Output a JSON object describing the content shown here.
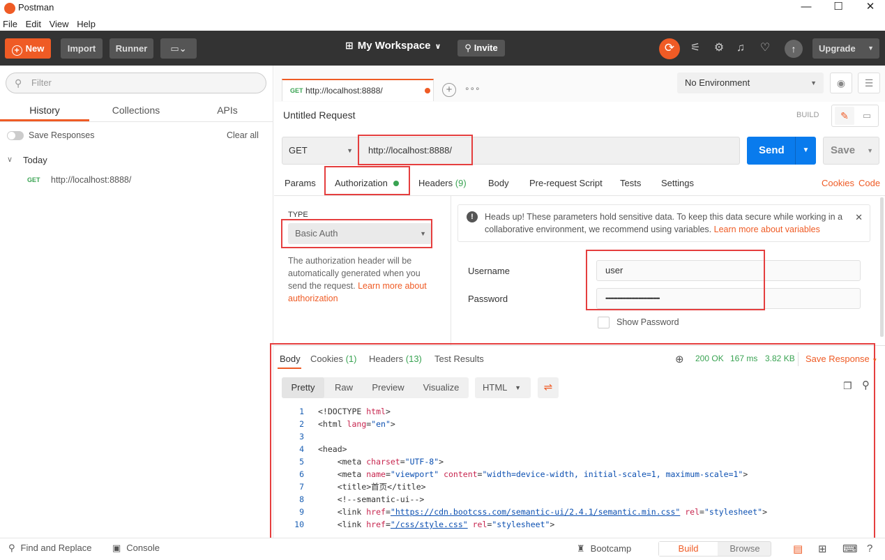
{
  "app": {
    "title": "Postman",
    "window_controls": {
      "minimize": "—",
      "maximize": "☐",
      "close": "✕"
    }
  },
  "menu": [
    "File",
    "Edit",
    "View",
    "Help"
  ],
  "toolbar": {
    "new_label": "New",
    "import_label": "Import",
    "runner_label": "Runner",
    "workspace_label": "My Workspace",
    "invite_label": "Invite",
    "upgrade_label": "Upgrade"
  },
  "sidebar": {
    "filter_placeholder": "Filter",
    "tabs": [
      "History",
      "Collections",
      "APIs"
    ],
    "active_tab": "History",
    "save_responses_label": "Save Responses",
    "clear_all_label": "Clear all",
    "group_label": "Today",
    "history_items": [
      {
        "method": "GET",
        "url": "http://localhost:8888/"
      }
    ]
  },
  "request_tab": {
    "method": "GET",
    "url": "http://localhost:8888/"
  },
  "environment": {
    "selected": "No Environment"
  },
  "request": {
    "name": "Untitled Request",
    "mode_label": "BUILD",
    "method": "GET",
    "url": "http://localhost:8888/",
    "send_label": "Send",
    "save_label": "Save",
    "tabs": [
      {
        "label": "Params",
        "count": ""
      },
      {
        "label": "Authorization",
        "count": ""
      },
      {
        "label": "Headers",
        "count": "(9)"
      },
      {
        "label": "Body",
        "count": ""
      },
      {
        "label": "Pre-request Script",
        "count": ""
      },
      {
        "label": "Tests",
        "count": ""
      },
      {
        "label": "Settings",
        "count": ""
      }
    ],
    "active_tab": "Authorization",
    "cookies_label": "Cookies",
    "code_label": "Code"
  },
  "auth": {
    "type_label": "TYPE",
    "type_value": "Basic Auth",
    "description": "The authorization header will be automatically generated when you send the request. ",
    "description_link": "Learn more about authorization",
    "warning_text": "Heads up! These parameters hold sensitive data. To keep this data secure while working in a collaborative environment, we recommend using variables. ",
    "warning_link": "Learn more about variables",
    "username_label": "Username",
    "username_value": "user",
    "password_label": "Password",
    "password_value": "••••••••••••••••••••••••••••••••••••",
    "show_password_label": "Show Password"
  },
  "response": {
    "tabs": [
      {
        "label": "Body",
        "count": ""
      },
      {
        "label": "Cookies",
        "count": "(1)"
      },
      {
        "label": "Headers",
        "count": "(13)"
      },
      {
        "label": "Test Results",
        "count": ""
      }
    ],
    "active_tab": "Body",
    "status": "200 OK",
    "time": "167 ms",
    "size": "3.82 KB",
    "save_response_label": "Save Response",
    "view_modes": [
      "Pretty",
      "Raw",
      "Preview",
      "Visualize"
    ],
    "active_view": "Pretty",
    "language": "HTML",
    "code_lines": [
      {
        "n": "1",
        "indent": "",
        "parts": [
          [
            "tag",
            "<!DOCTYPE "
          ],
          [
            "attr",
            "html"
          ],
          [
            "tag",
            ">"
          ]
        ]
      },
      {
        "n": "2",
        "indent": "",
        "parts": [
          [
            "tag",
            "<html "
          ],
          [
            "attr",
            "lang"
          ],
          [
            "tag",
            "="
          ],
          [
            "str",
            "\"en\""
          ],
          [
            "tag",
            ">"
          ]
        ]
      },
      {
        "n": "3",
        "indent": "",
        "parts": []
      },
      {
        "n": "4",
        "indent": "",
        "parts": [
          [
            "tag",
            "<head>"
          ]
        ]
      },
      {
        "n": "5",
        "indent": "    ",
        "parts": [
          [
            "tag",
            "<meta "
          ],
          [
            "attr",
            "charset"
          ],
          [
            "tag",
            "="
          ],
          [
            "str",
            "\"UTF-8\""
          ],
          [
            "tag",
            ">"
          ]
        ]
      },
      {
        "n": "6",
        "indent": "    ",
        "parts": [
          [
            "tag",
            "<meta "
          ],
          [
            "attr",
            "name"
          ],
          [
            "tag",
            "="
          ],
          [
            "str",
            "\"viewport\""
          ],
          [
            "tag",
            " "
          ],
          [
            "attr",
            "content"
          ],
          [
            "tag",
            "="
          ],
          [
            "str",
            "\"width=device-width, initial-scale=1, maximum-scale=1\""
          ],
          [
            "tag",
            ">"
          ]
        ]
      },
      {
        "n": "7",
        "indent": "    ",
        "parts": [
          [
            "tag",
            "<title>"
          ],
          [
            "tag",
            "首页"
          ],
          [
            "tag",
            "</title>"
          ]
        ]
      },
      {
        "n": "8",
        "indent": "    ",
        "parts": [
          [
            "comment",
            "<!--semantic-ui-->"
          ]
        ]
      },
      {
        "n": "9",
        "indent": "    ",
        "parts": [
          [
            "tag",
            "<link "
          ],
          [
            "attr",
            "href"
          ],
          [
            "tag",
            "="
          ],
          [
            "strul",
            "\"https://cdn.bootcss.com/semantic-ui/2.4.1/semantic.min.css\""
          ],
          [
            "tag",
            " "
          ],
          [
            "attr",
            "rel"
          ],
          [
            "tag",
            "="
          ],
          [
            "str",
            "\"stylesheet\""
          ],
          [
            "tag",
            ">"
          ]
        ]
      },
      {
        "n": "10",
        "indent": "    ",
        "parts": [
          [
            "tag",
            "<link "
          ],
          [
            "attr",
            "href"
          ],
          [
            "tag",
            "="
          ],
          [
            "strul",
            "\"/css/style.css\""
          ],
          [
            "tag",
            " "
          ],
          [
            "attr",
            "rel"
          ],
          [
            "tag",
            "="
          ],
          [
            "str",
            "\"stylesheet\""
          ],
          [
            "tag",
            ">"
          ]
        ]
      }
    ]
  },
  "statusbar": {
    "find_replace_label": "Find and Replace",
    "console_label": "Console",
    "bootcamp_label": "Bootcamp",
    "build_label": "Build",
    "browse_label": "Browse"
  },
  "colors": {
    "accent": "#ef5b25",
    "send_blue": "#097bed",
    "success": "#39a352",
    "highlight_red": "#e53e3e",
    "toolbar_bg": "#333333"
  }
}
